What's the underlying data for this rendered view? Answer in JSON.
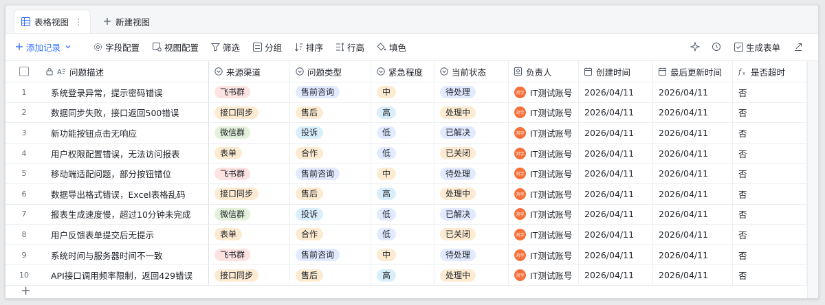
{
  "tabs": {
    "active_label": "表格视图",
    "new_label": "新建视图"
  },
  "toolbar": {
    "add_record": "添加记录",
    "field_config": "字段配置",
    "view_config": "视图配置",
    "filter": "筛选",
    "group": "分组",
    "sort": "排序",
    "row_height": "行高",
    "fill": "填色",
    "generate_form": "生成表单"
  },
  "columns": {
    "description": "问题描述",
    "source": "来源渠道",
    "type": "问题类型",
    "urgency": "紧急程度",
    "status": "当前状态",
    "owner": "负责人",
    "created": "创建时间",
    "updated": "最后更新时间",
    "timeout": "是否超时"
  },
  "avatar_text": "刘宇",
  "tag_colors": {
    "飞书群": "#fde2e2",
    "接口同步": "#fdebd1",
    "微信群": "#e3f0db",
    "表单": "#fdebd1",
    "售前咨询": "#e1eaff",
    "售后": "#fdebd1",
    "投诉": "#d9eefb",
    "合作": "#fdebd1",
    "中": "#fdebd1",
    "高": "#d9eefb",
    "低": "#e1eaff",
    "待处理": "#e1eaff",
    "处理中": "#fdebd1",
    "已解决": "#e1eaff",
    "已关闭": "#fdebd1"
  },
  "rows": [
    {
      "num": "1",
      "desc": "系统登录异常，提示密码错误",
      "source": "飞书群",
      "type": "售前咨询",
      "urgency": "中",
      "status": "待处理",
      "owner": "IT测试账号",
      "created": "2026/04/11",
      "updated": "2026/04/11",
      "timeout": "否"
    },
    {
      "num": "2",
      "desc": "数据同步失败，接口返回500错误",
      "source": "接口同步",
      "type": "售后",
      "urgency": "高",
      "status": "处理中",
      "owner": "IT测试账号",
      "created": "2026/04/11",
      "updated": "2026/04/11",
      "timeout": "否"
    },
    {
      "num": "3",
      "desc": "新功能按钮点击无响应",
      "source": "微信群",
      "type": "投诉",
      "urgency": "低",
      "status": "已解决",
      "owner": "IT测试账号",
      "created": "2026/04/11",
      "updated": "2026/04/11",
      "timeout": "否"
    },
    {
      "num": "4",
      "desc": "用户权限配置错误，无法访问报表",
      "source": "表单",
      "type": "合作",
      "urgency": "低",
      "status": "已关闭",
      "owner": "IT测试账号",
      "created": "2026/04/11",
      "updated": "2026/04/11",
      "timeout": "否"
    },
    {
      "num": "5",
      "desc": "移动端适配问题，部分按钮错位",
      "source": "飞书群",
      "type": "售前咨询",
      "urgency": "中",
      "status": "待处理",
      "owner": "IT测试账号",
      "created": "2026/04/11",
      "updated": "2026/04/11",
      "timeout": "否"
    },
    {
      "num": "6",
      "desc": "数据导出格式错误，Excel表格乱码",
      "source": "接口同步",
      "type": "售后",
      "urgency": "高",
      "status": "处理中",
      "owner": "IT测试账号",
      "created": "2026/04/11",
      "updated": "2026/04/11",
      "timeout": "否"
    },
    {
      "num": "7",
      "desc": "报表生成速度慢，超过10分钟未完成",
      "source": "微信群",
      "type": "投诉",
      "urgency": "低",
      "status": "已解决",
      "owner": "IT测试账号",
      "created": "2026/04/11",
      "updated": "2026/04/11",
      "timeout": "否"
    },
    {
      "num": "8",
      "desc": "用户反馈表单提交后无提示",
      "source": "表单",
      "type": "合作",
      "urgency": "低",
      "status": "已关闭",
      "owner": "IT测试账号",
      "created": "2026/04/11",
      "updated": "2026/04/11",
      "timeout": "否"
    },
    {
      "num": "9",
      "desc": "系统时间与服务器时间不一致",
      "source": "飞书群",
      "type": "售前咨询",
      "urgency": "中",
      "status": "待处理",
      "owner": "IT测试账号",
      "created": "2026/04/11",
      "updated": "2026/04/11",
      "timeout": "否"
    },
    {
      "num": "10",
      "desc": "API接口调用频率限制，返回429错误",
      "source": "接口同步",
      "type": "售后",
      "urgency": "高",
      "status": "处理中",
      "owner": "IT测试账号",
      "created": "2026/04/11",
      "updated": "2026/04/11",
      "timeout": "否"
    }
  ]
}
